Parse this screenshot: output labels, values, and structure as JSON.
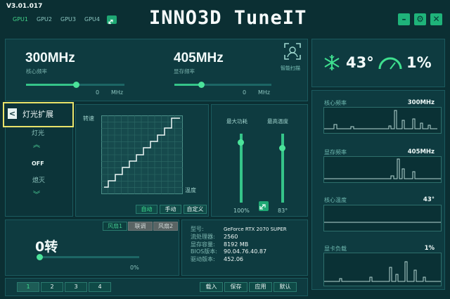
{
  "version": "V3.01.017",
  "gpu_tabs": [
    "GPU1",
    "GPU2",
    "GPU3",
    "GPU4"
  ],
  "title": "INNO3D TuneIT",
  "core": {
    "value": "300MHz",
    "label": "核心频率",
    "slider_val": "0",
    "unit": "MHz"
  },
  "mem": {
    "value": "405MHz",
    "label": "显存频率",
    "slider_val": "0",
    "unit": "MHz"
  },
  "smart_scan": "智能扫描",
  "status": {
    "temp": "43°",
    "load": "1%"
  },
  "led": {
    "title": "灯光扩展",
    "label": "灯光",
    "state": "OFF",
    "effect": "熄灭"
  },
  "fan_curve": {
    "ylabel": "转速",
    "xlabel": "温度",
    "modes": [
      "自动",
      "手动",
      "自定义"
    ]
  },
  "power": {
    "power_label": "最大功耗",
    "temp_label": "最高温度",
    "power_val": "100%",
    "temp_val": "83°"
  },
  "fan": {
    "tabs": [
      "风扇1",
      "联调",
      "风扇2"
    ],
    "speed": "0转",
    "percent": "0%"
  },
  "info": {
    "labels": [
      "型号:",
      "流处理器:",
      "显存容量:",
      "BIOS版本:",
      "驱动版本:"
    ],
    "values": [
      "GeForce RTX 2070 SUPER",
      "2560",
      "8192 MB",
      "90.04.76.40.87",
      "452.06"
    ]
  },
  "profiles": [
    "1",
    "2",
    "3",
    "4"
  ],
  "actions": [
    "载入",
    "保存",
    "应用",
    "默认"
  ],
  "monitor": [
    {
      "label": "核心频率",
      "value": "300MHz"
    },
    {
      "label": "显存频率",
      "value": "405MHz"
    },
    {
      "label": "核心温度",
      "value": "43°"
    },
    {
      "label": "显卡负载",
      "value": "1%"
    }
  ]
}
